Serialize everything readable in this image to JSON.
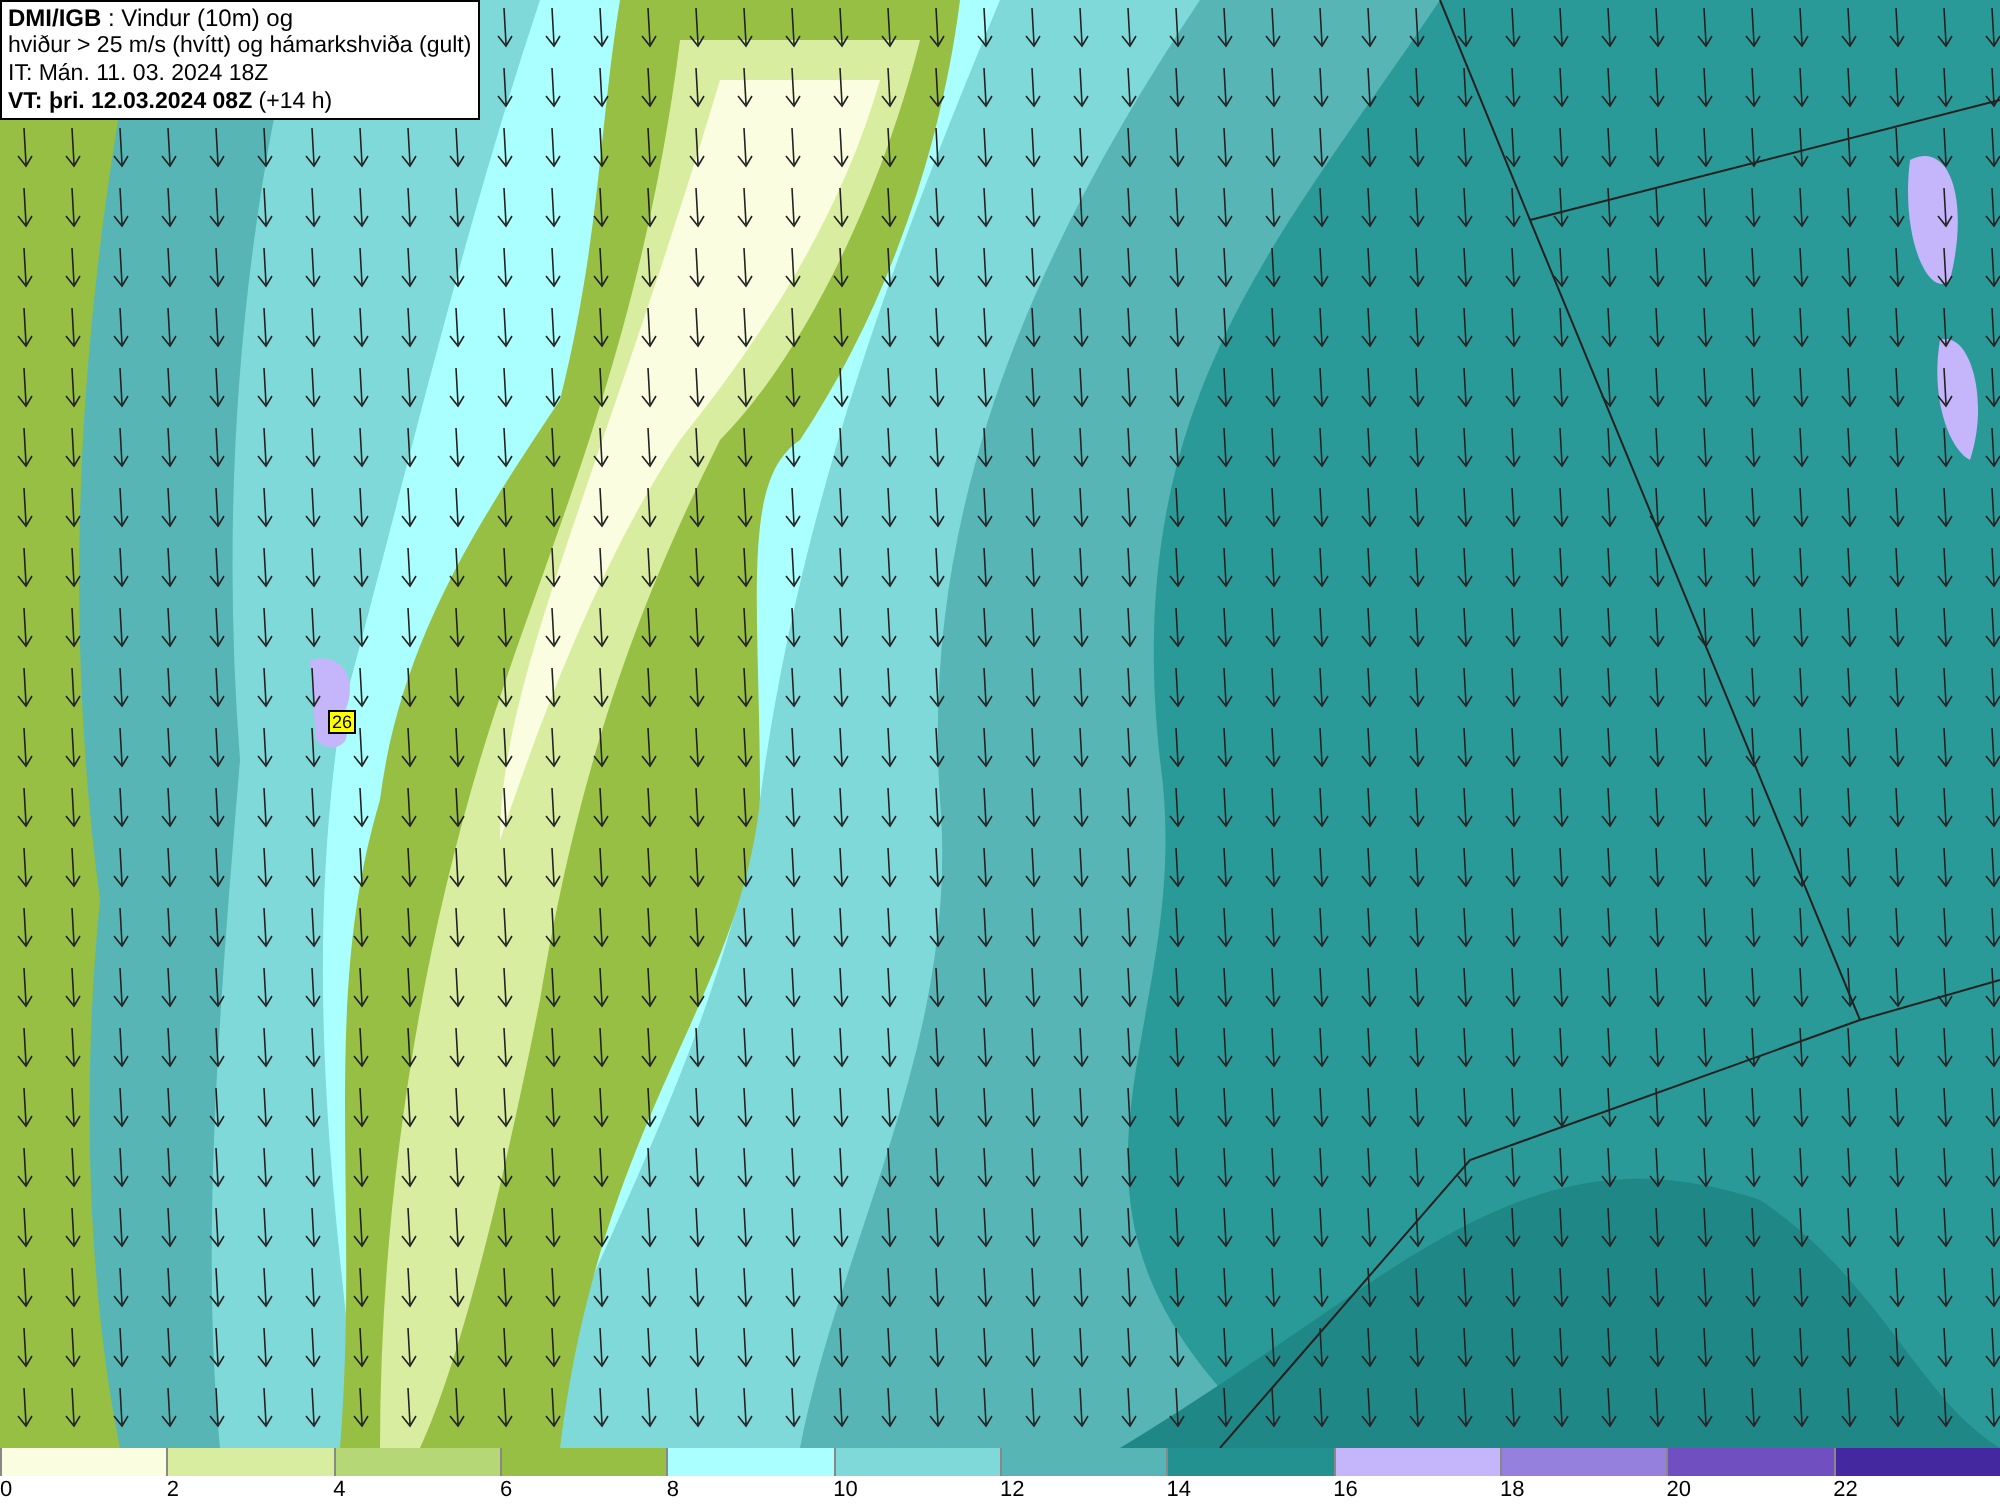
{
  "info_box": {
    "lines": [
      "**DMI/IGB** : Vindur (10m) og",
      "hviður > 25 m/s (hvítt) og hámarkshviða (gult)",
      "IT: Mán. 11. 03. 2024 18Z",
      "**VT: þri. 12.03.2024 08Z** (+14 h)"
    ]
  },
  "map": {
    "gust_labels": [
      "26"
    ]
  },
  "legend": {
    "items": [
      {
        "label": "0",
        "color": "#fafde0"
      },
      {
        "label": "2",
        "color": "#d9eda0"
      },
      {
        "label": "4",
        "color": "#b6d775"
      },
      {
        "label": "6",
        "color": "#96bf43"
      },
      {
        "label": "8",
        "color": "#aaffff"
      },
      {
        "label": "10",
        "color": "#7fd9d9"
      },
      {
        "label": "12",
        "color": "#57b5b5"
      },
      {
        "label": "14",
        "color": "#22918f"
      },
      {
        "label": "16",
        "color": "#c5b5fb"
      },
      {
        "label": "18",
        "color": "#9580dd"
      },
      {
        "label": "20",
        "color": "#7050c0"
      },
      {
        "label": "22",
        "color": "#4428a0"
      }
    ]
  }
}
